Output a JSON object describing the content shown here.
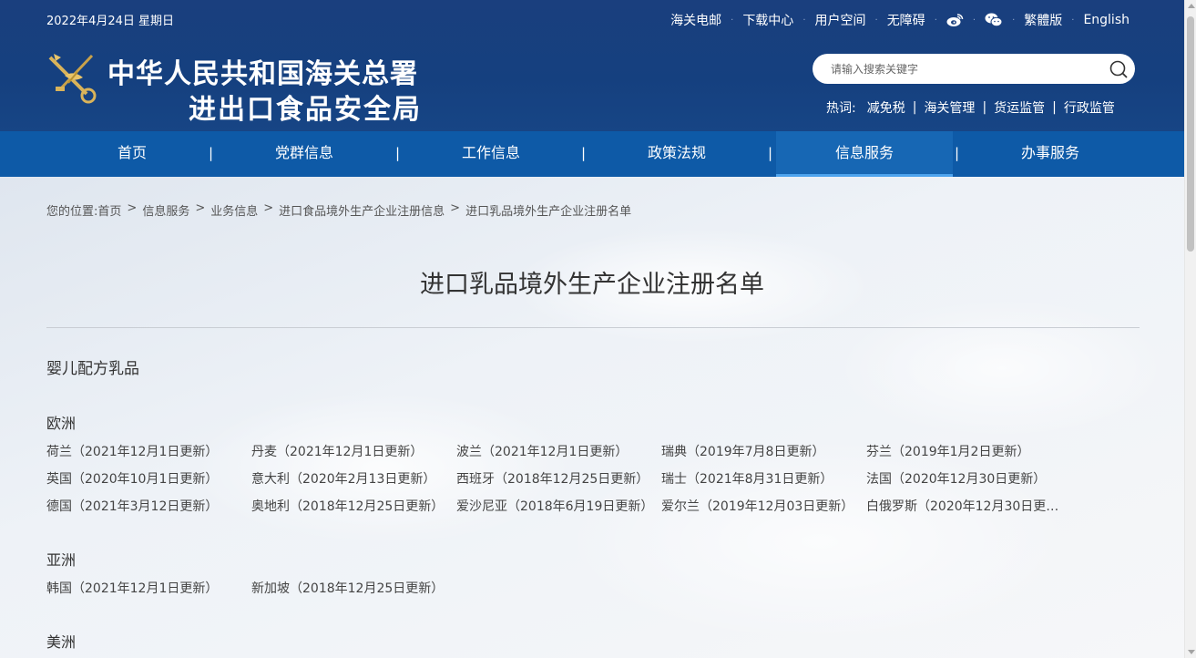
{
  "header": {
    "date": "2022年4月24日 星期日",
    "toplinks": [
      "海关电邮",
      "下载中心",
      "用户空间",
      "无障碍"
    ],
    "traditional": "繁體版",
    "english": "English",
    "title_line1": "中华人民共和国海关总署",
    "title_line2": "进出口食品安全局",
    "search_placeholder": "请输入搜索关键字",
    "hot_label": "热词:",
    "hot_words": [
      "减免税",
      "海关管理",
      "货运监管",
      "行政监管"
    ]
  },
  "nav": {
    "items": [
      "首页",
      "党群信息",
      "工作信息",
      "政策法规",
      "信息服务",
      "办事服务"
    ],
    "active": "信息服务"
  },
  "breadcrumb": {
    "prefix": "您的位置:",
    "items": [
      "首页",
      "信息服务",
      "业务信息",
      "进口食品境外生产企业注册信息",
      "进口乳品境外生产企业注册名单"
    ]
  },
  "main": {
    "page_title": "进口乳品境外生产企业注册名单",
    "section": "婴儿配方乳品",
    "regions": [
      {
        "name": "欧洲",
        "countries": [
          "荷兰（2021年12月1日更新）",
          "丹麦（2021年12月1日更新）",
          "波兰（2021年12月1日更新）",
          "瑞典（2019年7月8日更新）",
          "芬兰（2019年1月2日更新）",
          "英国（2020年10月1日更新）",
          "意大利（2020年2月13日更新）",
          "西班牙（2018年12月25日更新）",
          "瑞士（2021年8月31日更新）",
          "法国（2020年12月30日更新）",
          "德国（2021年3月12日更新）",
          "奥地利（2018年12月25日更新）",
          "爱沙尼亚（2018年6月19日更新）",
          "爱尔兰（2019年12月03日更新）",
          "白俄罗斯（2020年12月30日更新..."
        ]
      },
      {
        "name": "亚洲",
        "countries": [
          "韩国（2021年12月1日更新）",
          "新加坡（2018年12月25日更新）"
        ]
      },
      {
        "name": "美洲",
        "countries": []
      }
    ]
  },
  "colors": {
    "header_bg": "#1a3f7e",
    "nav_bg": "#0e5aa7",
    "nav_active_underline": "#4ea4ee",
    "logo_gold": "#d9b35a"
  }
}
